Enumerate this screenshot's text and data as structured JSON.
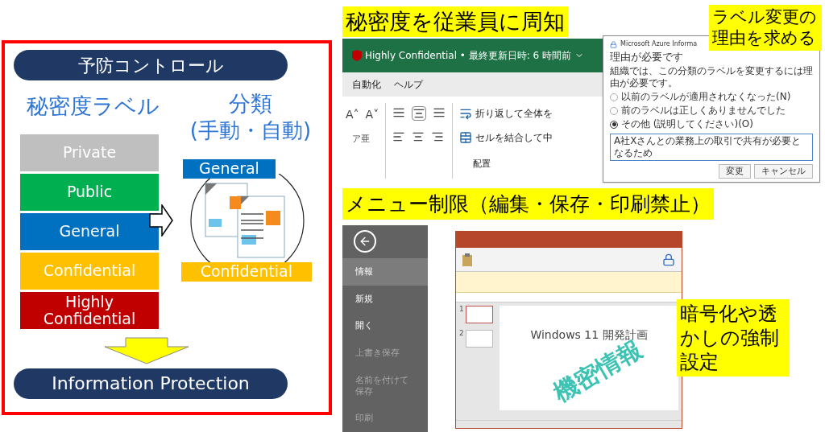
{
  "preventive_panel": {
    "title": "予防コントロール",
    "labels_heading": "秘密度ラベル",
    "classification_heading": "分類",
    "classification_subheading": "(手動・自動)",
    "labels": [
      {
        "name": "Private",
        "color": "#bfbfbf"
      },
      {
        "name": "Public",
        "color": "#00b050"
      },
      {
        "name": "General",
        "color": "#0070c0"
      },
      {
        "name": "Confidential",
        "color": "#ffc000"
      },
      {
        "name": "Highly Confidential",
        "color": "#c00000"
      }
    ],
    "document_labels": [
      {
        "name": "General",
        "color": "#0070c0"
      },
      {
        "name": "Confidential",
        "color": "#ffc000"
      }
    ],
    "footer": "Information Protection"
  },
  "callouts": {
    "notify": "秘密度を従業員に周知",
    "justify": "ラベル変更の理由を求める",
    "menu": "メニュー制限（編集・保存・印刷禁止）",
    "encrypt": "暗号化や透かしの強制設定"
  },
  "excel": {
    "font_size_buttons": [
      "A˄",
      "A˅"
    ],
    "phonetic_button": "ア亜",
    "label_bar": "Highly Confidential • 最終更新日時: 6 時間前",
    "menu": [
      "自動化",
      "ヘルプ"
    ],
    "wrap_text": "折り返して全体を",
    "merge_cells": "セルを結合して中",
    "group_label": "配置"
  },
  "dialog": {
    "title": "Microsoft Azure Informa",
    "heading": "理由が必要です",
    "message": "組織では、この分類のラベルを変更するには理由が必要です。",
    "options": [
      {
        "label": "以前のラベルが適用されなくなった(N)",
        "selected": false
      },
      {
        "label": "前のラベルは正しくありませんでした",
        "selected": false
      },
      {
        "label": "その他 (説明してください)(O)",
        "selected": true
      }
    ],
    "justification": "A社Xさんとの業務上の取引で共有が必要となるため",
    "buttons": [
      "変更",
      "キャンセル"
    ]
  },
  "backstage": {
    "items": [
      {
        "label": "情報",
        "selected": true,
        "disabled": false
      },
      {
        "label": "新規",
        "selected": false,
        "disabled": false
      },
      {
        "label": "開く",
        "selected": false,
        "disabled": false
      },
      {
        "label": "上書き保存",
        "selected": false,
        "disabled": true
      },
      {
        "label": "名前を付けて保存",
        "selected": false,
        "disabled": true
      },
      {
        "label": "印刷",
        "selected": false,
        "disabled": true
      }
    ]
  },
  "powerpoint": {
    "slide_numbers": [
      "1",
      "2"
    ],
    "slide_title": "Windows 11 開発計画",
    "watermark": "機密情報"
  }
}
